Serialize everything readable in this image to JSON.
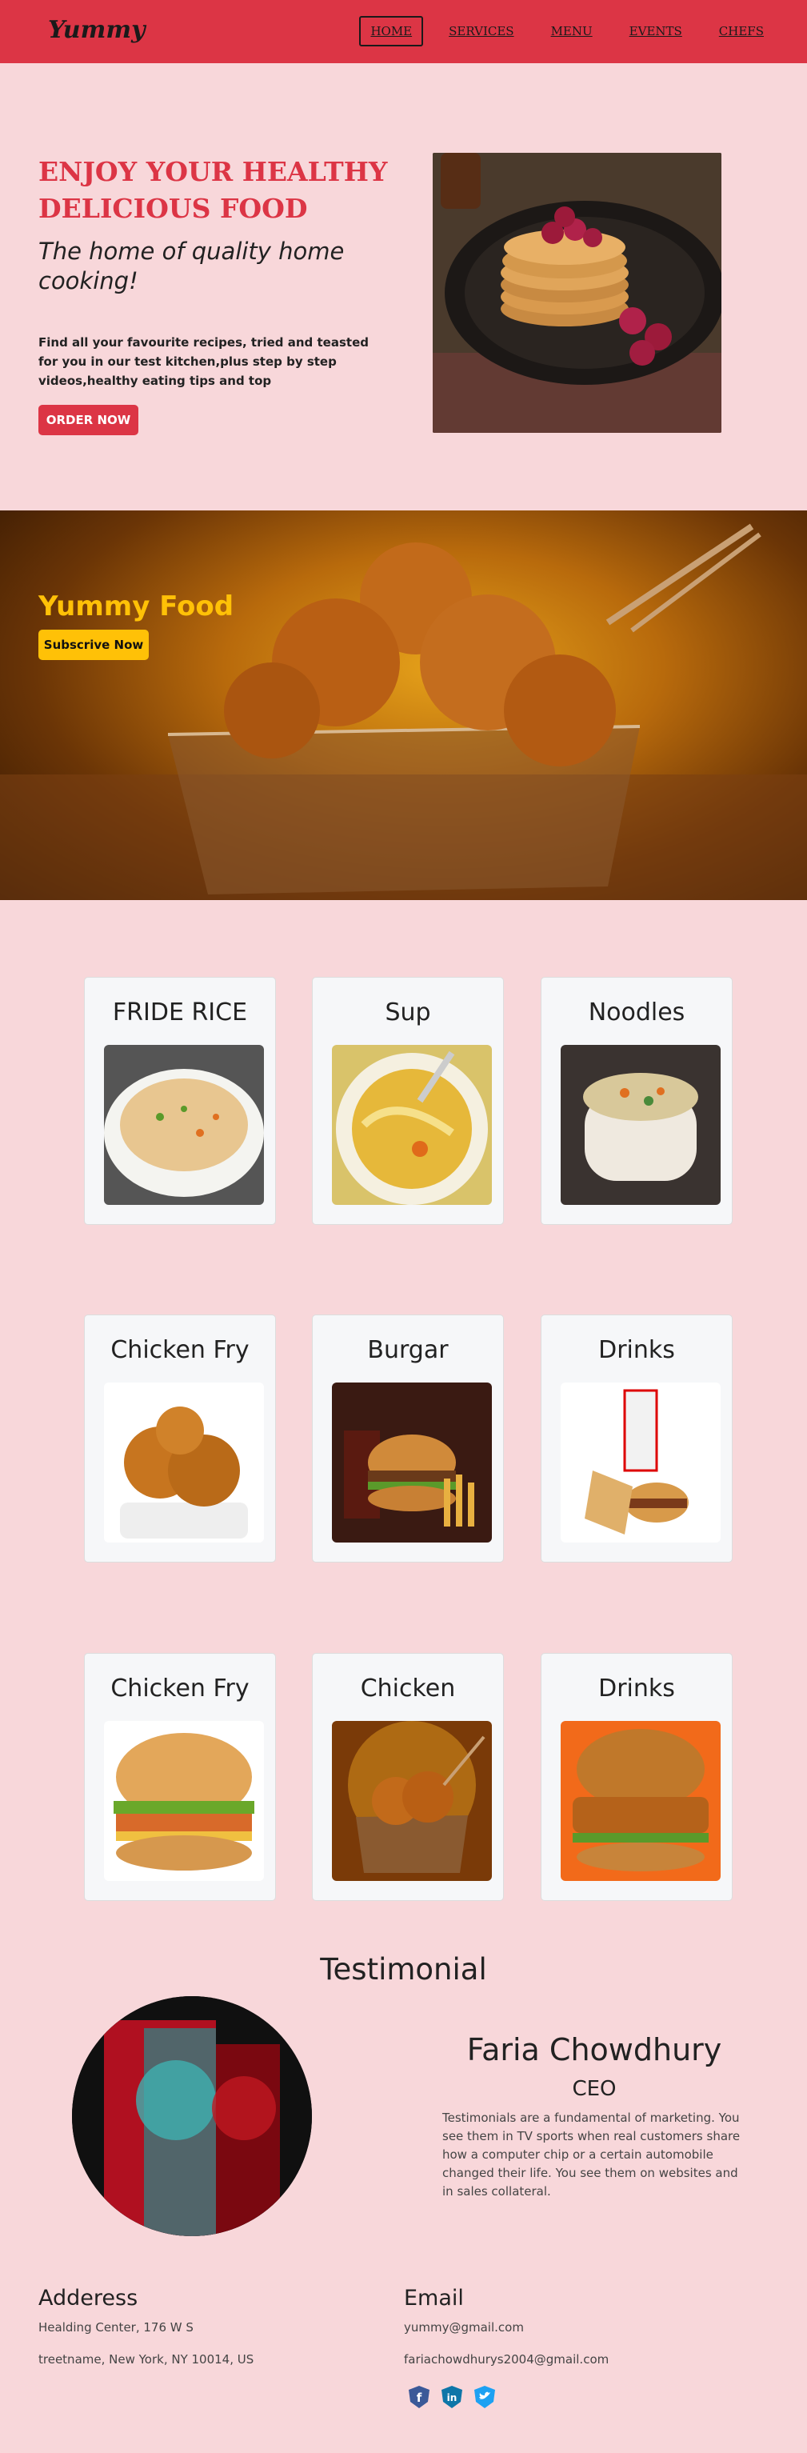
{
  "nav": {
    "brand": "Yummy",
    "links": [
      "HOME",
      "SERVICES",
      "MENU",
      "EVENTS",
      "CHEFS"
    ]
  },
  "hero": {
    "title_line1": "ENJOY YOUR HEALTHY",
    "title_line2": "DELICIOUS FOOD",
    "subtitle": "The home of quality home cooking!",
    "description": "Find all your favourite recipes, tried and teasted for you in our test kitchen,plus step by step videos,healthy eating tips and top",
    "button": "ORDER NOW"
  },
  "banner": {
    "title": "Yummy Food",
    "button": "Subscrive Now"
  },
  "cards": [
    {
      "title": "FRIDE RICE"
    },
    {
      "title": "Sup"
    },
    {
      "title": "Noodles"
    },
    {
      "title": "Chicken Fry"
    },
    {
      "title": "Burgar"
    },
    {
      "title": "Drinks"
    },
    {
      "title": "Chicken Fry"
    },
    {
      "title": "Chicken"
    },
    {
      "title": "Drinks"
    }
  ],
  "testimonial": {
    "heading": "Testimonial",
    "name": "Faria Chowdhury",
    "role": "CEO",
    "text": "Testimonials are a fundamental of marketing. You see them in TV sports when real customers share how a computer chip or a certain automobile changed their life. You see them on websites and in sales collateral."
  },
  "footer": {
    "address_heading": "Adderess",
    "address_line1": "Healding Center, 176 W S",
    "address_line2": "treetname, New York, NY 10014, US",
    "email_heading": "Email",
    "email1": "yummy@gmail.com",
    "email2": "fariachowdhurys2004@gmail.com",
    "social": [
      {
        "icon": "facebook-icon",
        "glyph": "f",
        "color": "#3b5998"
      },
      {
        "icon": "linkedin-icon",
        "glyph": "in",
        "color": "#0e76a8"
      },
      {
        "icon": "twitter-icon",
        "glyph": "t",
        "color": "#1da1f2"
      }
    ]
  },
  "colors": {
    "primary": "#dc3545",
    "accent": "#ffc107",
    "background": "#f8d7da"
  }
}
